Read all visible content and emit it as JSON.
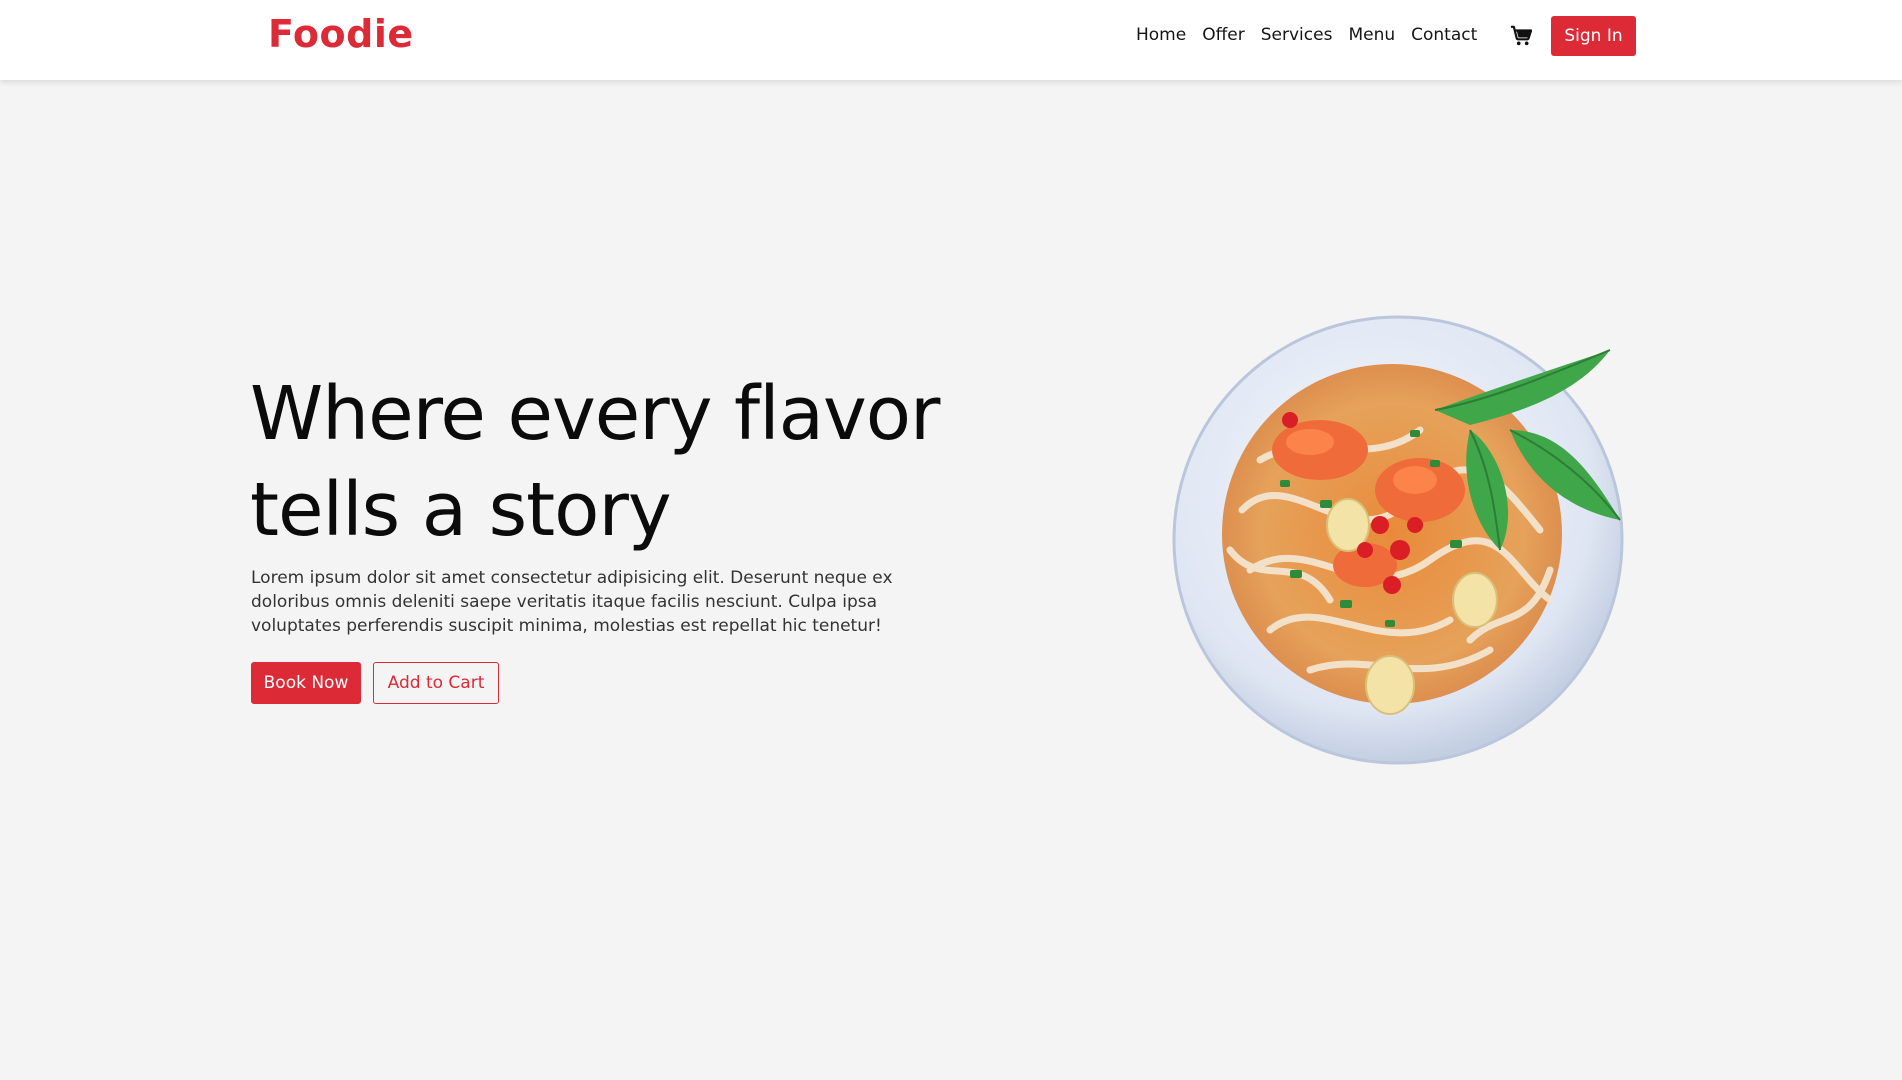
{
  "brand": {
    "name": "Foodie",
    "color": "#dc2a36"
  },
  "nav": {
    "links": [
      "Home",
      "Offer",
      "Services",
      "Menu",
      "Contact"
    ],
    "cart_icon": "cart-icon",
    "signin_label": "Sign In"
  },
  "hero": {
    "title_line1": "Where every flavor",
    "title_line2": "tells a story",
    "text": "Lorem ipsum dolor sit amet consectetur adipisicing elit. Deserunt neque ex doloribus omnis deleniti saepe veritatis itaque facilis nesciunt. Culpa ipsa voluptates perferendis suscipit minima, molestias est repellat hic tenetur!",
    "primary_button": "Book Now",
    "secondary_button": "Add to Cart"
  },
  "colors": {
    "accent": "#dc2a36",
    "background": "#f4f4f4",
    "header": "#ffffff"
  }
}
